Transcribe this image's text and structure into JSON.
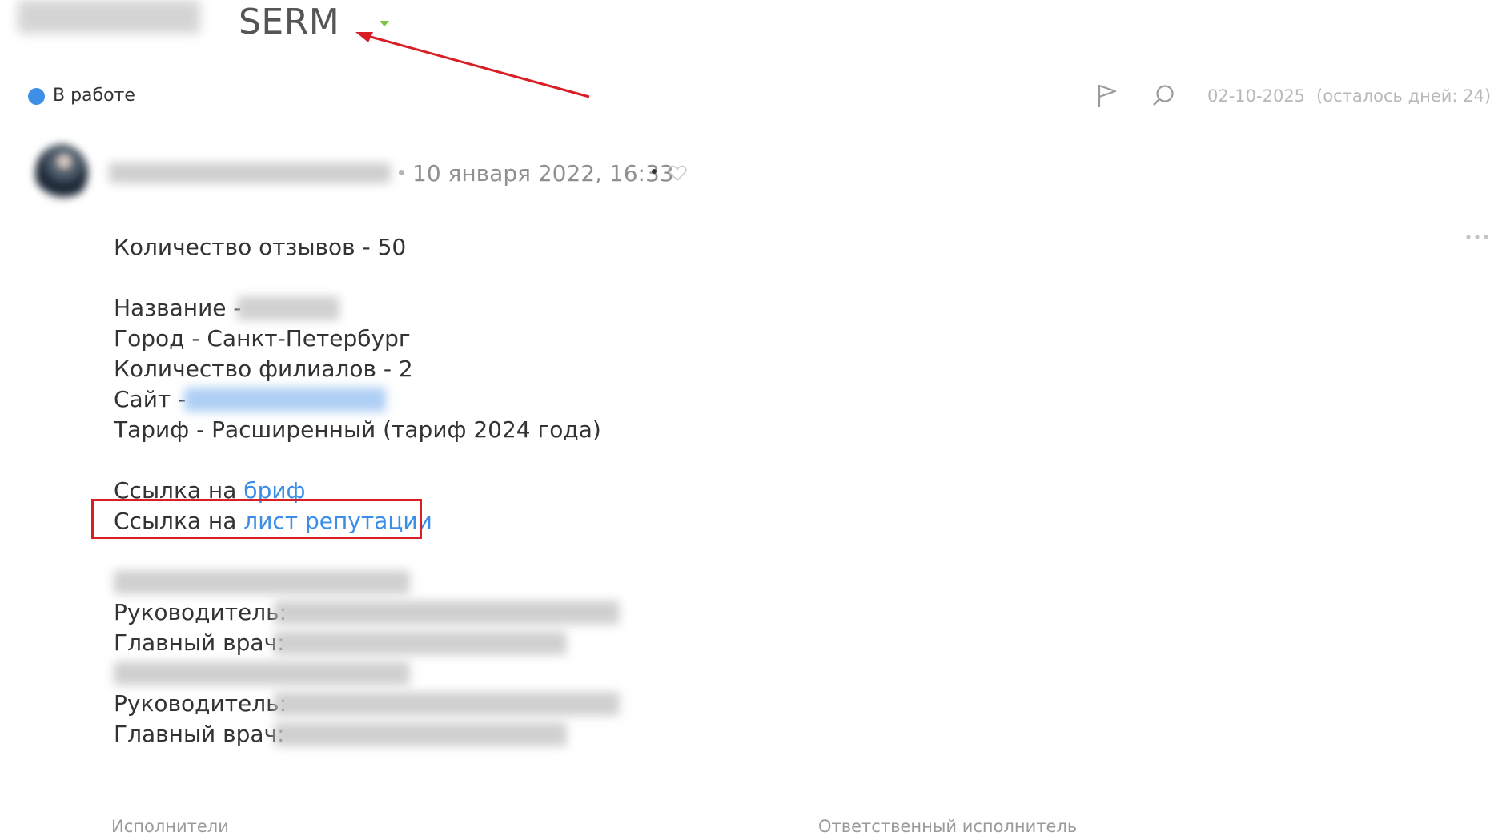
{
  "header": {
    "title": "SERM",
    "dropdown_icon": "caret-down-icon",
    "dropdown_color": "#7cc241"
  },
  "status": {
    "label": "В работе",
    "color": "#3d8fe8"
  },
  "toolbar": {
    "flag_icon": "flag-icon",
    "comment_icon": "comment-icon",
    "deadline_date": "02-10-2025",
    "deadline_remaining": "(осталось дней: 24)"
  },
  "post": {
    "date": "10 января 2022, 16:33",
    "like_icon": "heart-icon",
    "more_icon": "more-dots-icon",
    "lines": {
      "reviews": "Количество отзывов - 50",
      "name_label": "Название -",
      "city": "Город - Санкт-Петербург",
      "branches": "Количество филиалов - 2",
      "site_label": "Сайт -",
      "tariff": "Тариф - Расширенный (тариф 2024 года)",
      "brief_prefix": "Ссылка на",
      "brief_link": "бриф",
      "reputation_prefix": "Ссылка на",
      "reputation_link": "лист репутации",
      "head1_label": "Руководитель:",
      "doctor1_label": "Главный врач:",
      "head2_label": "Руководитель:",
      "doctor2_label": "Главный врач:"
    }
  },
  "footer": {
    "executors_label": "Исполнители",
    "responsible_label": "Ответственный исполнитель"
  },
  "colors": {
    "link": "#3b8ee8",
    "annotation": "#d91f26"
  }
}
